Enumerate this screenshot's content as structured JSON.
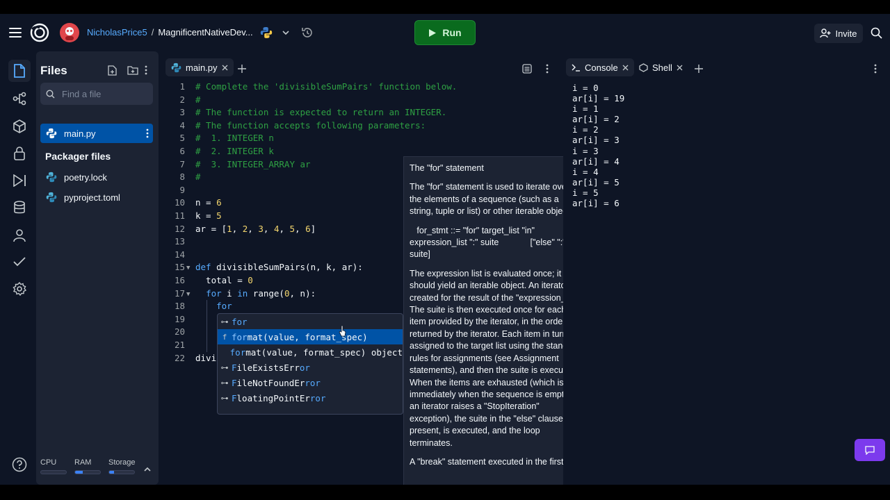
{
  "header": {
    "username": "NicholasPrice5",
    "separator": "/",
    "repl_name": "MagnificentNativeDev...",
    "run_label": "Run",
    "invite_label": "Invite"
  },
  "rail": {
    "icons": [
      "files-icon",
      "git-icon",
      "packages-icon",
      "secrets-icon",
      "debugger-icon",
      "database-icon",
      "user-icon",
      "check-icon",
      "settings-icon"
    ]
  },
  "files_panel": {
    "title": "Files",
    "search_placeholder": "Find a file",
    "active_file": "main.py",
    "packager_title": "Packager files",
    "packager_files": [
      "poetry.lock",
      "pyproject.toml"
    ]
  },
  "usage": {
    "labels": [
      "CPU",
      "RAM",
      "Storage"
    ],
    "levels": [
      0.0,
      0.3,
      0.2
    ]
  },
  "editor": {
    "tab_label": "main.py",
    "lines": [
      {
        "n": "1",
        "segs": [
          [
            "# Complete the 'divisibleSumPairs' function below.",
            "com"
          ]
        ]
      },
      {
        "n": "2",
        "segs": [
          [
            "#",
            "com"
          ]
        ]
      },
      {
        "n": "3",
        "segs": [
          [
            "# The function is expected to return an INTEGER.",
            "com"
          ]
        ]
      },
      {
        "n": "4",
        "segs": [
          [
            "# The function accepts following parameters:",
            "com"
          ]
        ]
      },
      {
        "n": "5",
        "segs": [
          [
            "#  1. INTEGER n",
            "com"
          ]
        ]
      },
      {
        "n": "6",
        "segs": [
          [
            "#  2. INTEGER k",
            "com"
          ]
        ]
      },
      {
        "n": "7",
        "segs": [
          [
            "#  3. INTEGER_ARRAY ar",
            "com"
          ]
        ]
      },
      {
        "n": "8",
        "segs": [
          [
            "#",
            "com"
          ]
        ]
      },
      {
        "n": "9",
        "segs": []
      },
      {
        "n": "10",
        "segs": [
          [
            "n = ",
            "var"
          ],
          [
            "6",
            "num"
          ]
        ]
      },
      {
        "n": "11",
        "segs": [
          [
            "k = ",
            "var"
          ],
          [
            "5",
            "num"
          ]
        ]
      },
      {
        "n": "12",
        "segs": [
          [
            "ar = [",
            "var"
          ],
          [
            "1",
            "num"
          ],
          [
            ", ",
            "var"
          ],
          [
            "2",
            "num"
          ],
          [
            ", ",
            "var"
          ],
          [
            "3",
            "num"
          ],
          [
            ", ",
            "var"
          ],
          [
            "4",
            "num"
          ],
          [
            ", ",
            "var"
          ],
          [
            "5",
            "num"
          ],
          [
            ", ",
            "var"
          ],
          [
            "6",
            "num"
          ],
          [
            "]",
            "var"
          ]
        ]
      },
      {
        "n": "13",
        "segs": []
      },
      {
        "n": "14",
        "segs": []
      },
      {
        "n": "15",
        "fold": true,
        "segs": [
          [
            "def ",
            "kw"
          ],
          [
            "divisibleSumPairs(n, k, ar):",
            "fn"
          ]
        ]
      },
      {
        "n": "16",
        "segs": [
          [
            "  total = ",
            "var"
          ],
          [
            "0",
            "num"
          ]
        ]
      },
      {
        "n": "17",
        "fold": true,
        "segs": [
          [
            "  ",
            "var"
          ],
          [
            "for",
            "kw"
          ],
          [
            " i ",
            "var"
          ],
          [
            "in",
            "kw"
          ],
          [
            " range(",
            "var"
          ],
          [
            "0",
            "num"
          ],
          [
            ", n):",
            "var"
          ]
        ]
      },
      {
        "n": "18",
        "segs": [
          [
            "    ",
            "var"
          ],
          [
            "for",
            "kw"
          ]
        ]
      },
      {
        "n": "19",
        "segs": []
      },
      {
        "n": "20",
        "segs": []
      },
      {
        "n": "21",
        "segs": []
      },
      {
        "n": "22",
        "segs": [
          [
            "divi",
            "var"
          ]
        ]
      }
    ]
  },
  "autocomplete": {
    "items": [
      {
        "icon": "⊶",
        "hl": "for",
        "rest": "",
        "selected": false
      },
      {
        "icon": "f",
        "hl": "for",
        "rest": "mat(value, format_spec)",
        "selected": true
      },
      {
        "icon": "",
        "hl": "for",
        "rest": "mat(value, format_spec) object",
        "selected": false
      },
      {
        "icon": "⊶",
        "hl": "F",
        "rest": "ileExistsErr",
        "tail": "or",
        "selected": false
      },
      {
        "icon": "⊶",
        "hl": "F",
        "rest": "ileNotFoundEr",
        "tail": "ror",
        "selected": false
      },
      {
        "icon": "⊶",
        "hl": "F",
        "rest": "loatingPointEr",
        "tail": "ror",
        "selected": false
      }
    ]
  },
  "doc_tooltip": {
    "title": "The \"for\" statement",
    "p1": "The \"for\" statement is used to iterate over the elements of a sequence (such as a string, tuple or list) or other iterable object:",
    "p2": "   for_stmt ::= \"for\" target_list \"in\" expression_list \":\" suite             [\"else\" \":\" suite]",
    "p3": "The expression list is evaluated once; it should yield an iterable object.  An iterator is created for the result of the \"expression_list\".  The suite is then executed once for each item provided by the iterator, in the order returned by the iterator.  Each item in turn is assigned to the target list using the standard rules for assignments (see Assignment statements), and then the suite is executed.  When the items are exhausted (which is immediately when the sequence is empty or an iterator raises a \"StopIteration\" exception), the suite in the \"else\" clause, if present, is executed, and the loop terminates.",
    "p4": "A \"break\" statement executed in the first"
  },
  "console": {
    "tab_console": "Console",
    "tab_shell": "Shell",
    "output": "i = 0\nar[i] = 19\ni = 1\nar[i] = 2\ni = 2\nar[i] = 3\ni = 3\nar[i] = 4\ni = 4\nar[i] = 5\ni = 5\nar[i] = 6"
  }
}
